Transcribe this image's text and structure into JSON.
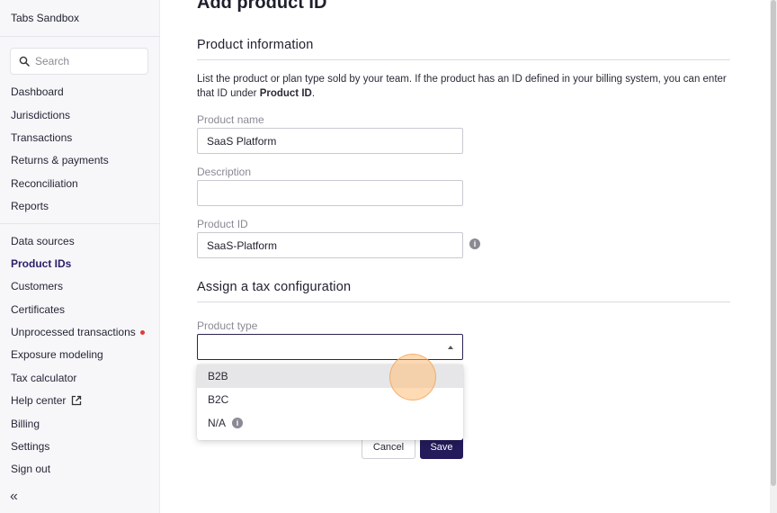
{
  "sidebar": {
    "org_name": "Tabs Sandbox",
    "search_placeholder": "Search",
    "nav_primary": [
      "Dashboard",
      "Jurisdictions",
      "Transactions",
      "Returns & payments",
      "Reconciliation",
      "Reports"
    ],
    "nav_secondary": [
      "Data sources",
      "Product IDs",
      "Customers",
      "Certificates",
      "Unprocessed transactions",
      "Exposure modeling",
      "Tax calculator",
      "Help center",
      "Billing",
      "Settings",
      "Sign out"
    ],
    "active_item": "Product IDs",
    "collapse_glyph": "«"
  },
  "main": {
    "page_title": "Add product ID",
    "product_info": {
      "heading": "Product information",
      "description_prefix": "List the product or plan type sold by your team. If the product has an ID defined in your billing system, you can enter that ID under ",
      "description_bold": "Product ID",
      "description_suffix": ".",
      "product_name_label": "Product name",
      "product_name_value": "SaaS Platform",
      "description_label": "Description",
      "description_value": "",
      "product_id_label": "Product ID",
      "product_id_value": "SaaS-Platform",
      "info_glyph": "i"
    },
    "tax_config": {
      "heading": "Assign a tax configuration",
      "product_type_label": "Product type",
      "product_type_value": "",
      "options": [
        "B2B",
        "B2C",
        "N/A"
      ],
      "hovered_option": "B2B"
    },
    "buttons": {
      "cancel": "Cancel",
      "save": "Save"
    }
  },
  "colors": {
    "accent": "#231b5a",
    "active_nav": "#2a2168",
    "alert_dot": "#e03a3a",
    "sidebar_bg": "#f7f7fa"
  },
  "icons": {
    "search": "search-icon",
    "external_link": "external-link-icon",
    "info": "info-icon",
    "caret": "caret-up-icon",
    "collapse": "double-chevron-left-icon"
  }
}
